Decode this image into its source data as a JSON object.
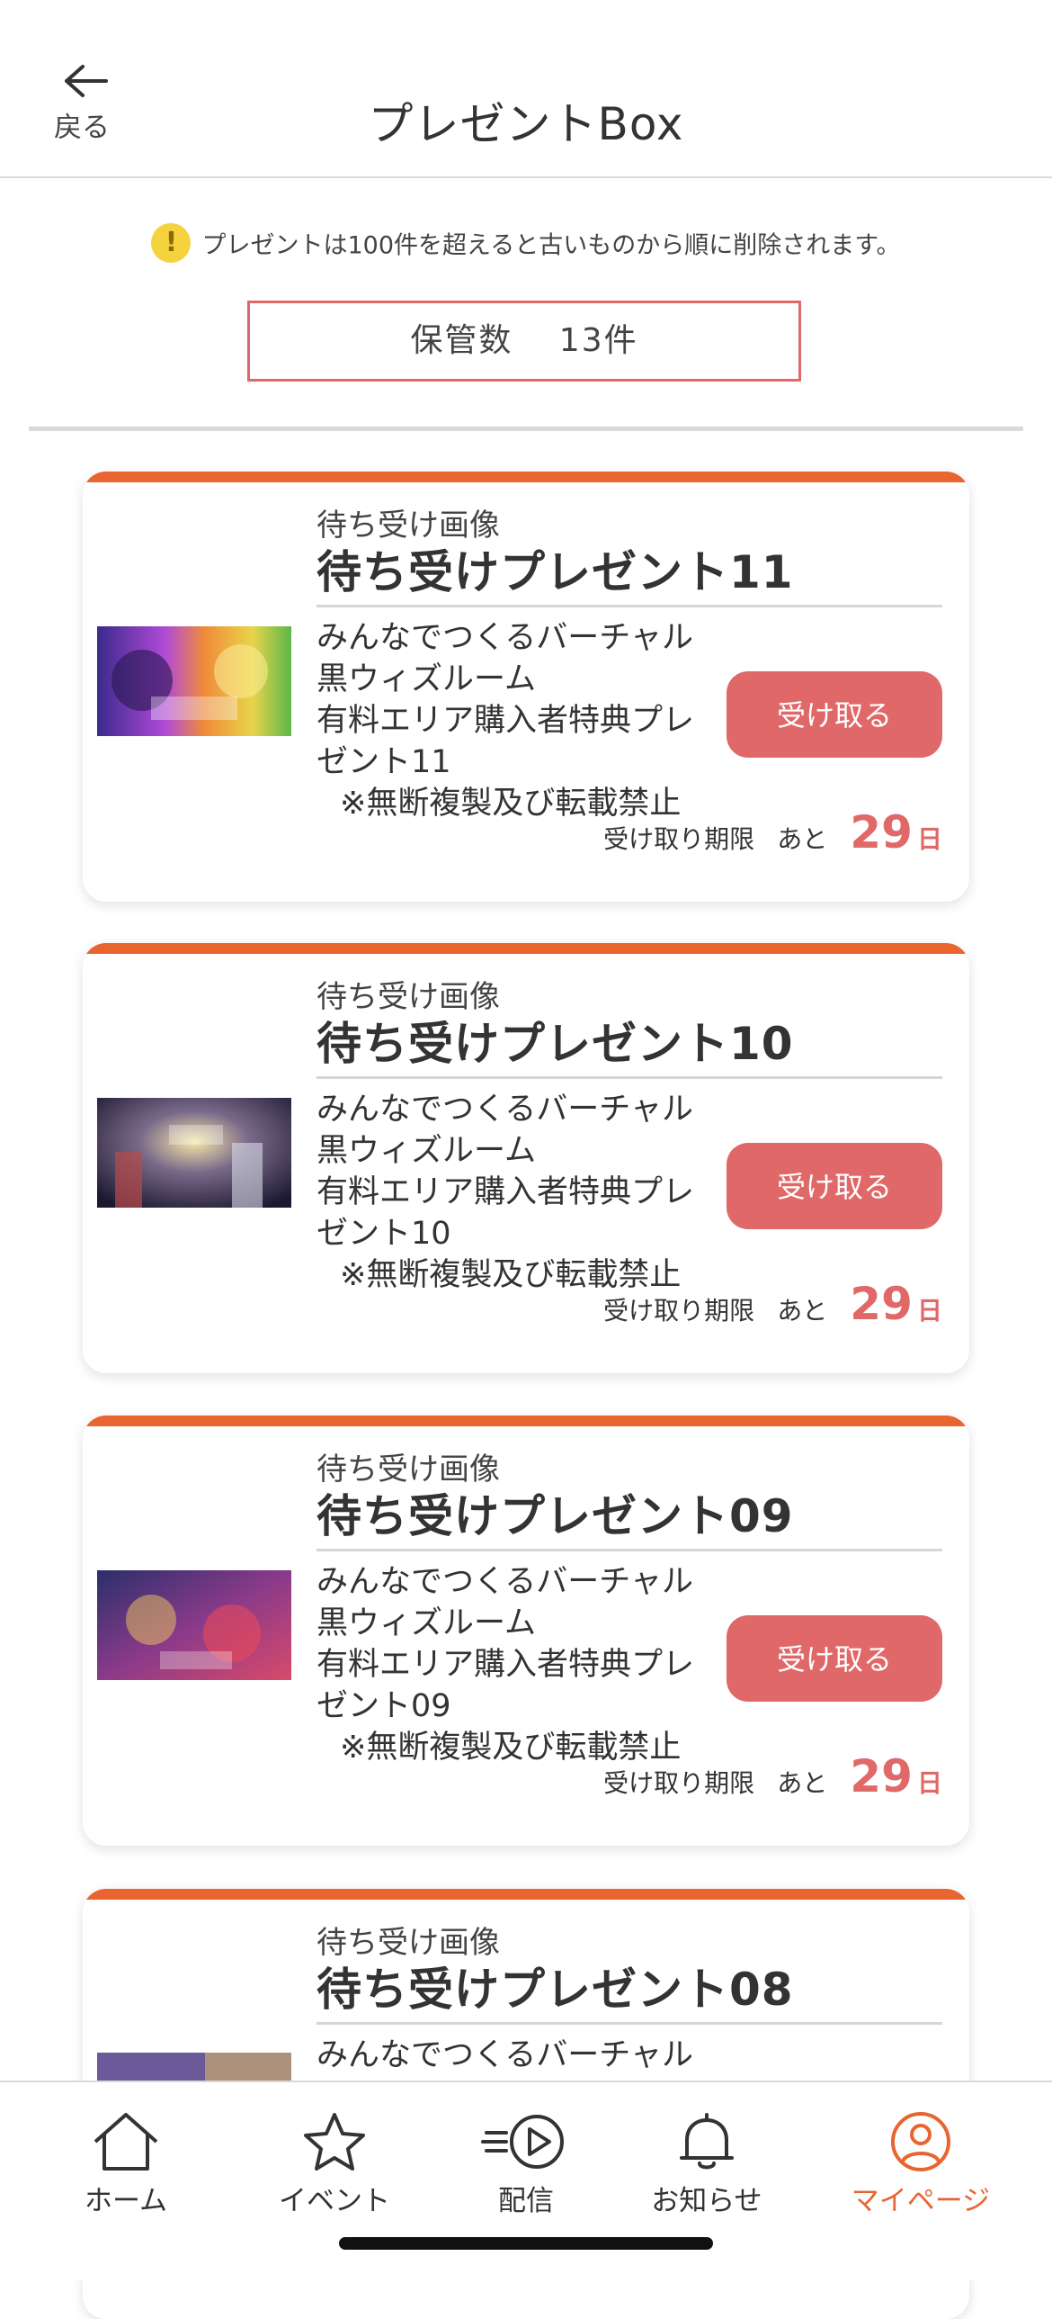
{
  "header": {
    "back_label": "戻る",
    "title": "プレゼントBox"
  },
  "notice": {
    "icon": "warning-icon",
    "text": "プレゼントは100件を超えると古いものから順に削除されます。"
  },
  "storage": {
    "label": "保管数　 13件"
  },
  "cards": [
    {
      "category": "待ち受け画像",
      "name": "待ち受けプレゼント11",
      "desc_lines": [
        "みんなでつくるバーチャル",
        "黒ウィズルーム",
        "有料エリア購入者特典プレ",
        "ゼント11"
      ],
      "notice": "※無断複製及び転載禁止",
      "button": "受け取る",
      "deadline_label": "受け取り期限",
      "remaining_prefix": "あと",
      "remaining_days": "29",
      "remaining_unit": "日"
    },
    {
      "category": "待ち受け画像",
      "name": "待ち受けプレゼント10",
      "desc_lines": [
        "みんなでつくるバーチャル",
        "黒ウィズルーム",
        "有料エリア購入者特典プレ",
        "ゼント10"
      ],
      "notice": "※無断複製及び転載禁止",
      "button": "受け取る",
      "deadline_label": "受け取り期限",
      "remaining_prefix": "あと",
      "remaining_days": "29",
      "remaining_unit": "日"
    },
    {
      "category": "待ち受け画像",
      "name": "待ち受けプレゼント09",
      "desc_lines": [
        "みんなでつくるバーチャル",
        "黒ウィズルーム",
        "有料エリア購入者特典プレ",
        "ゼント09"
      ],
      "notice": "※無断複製及び転載禁止",
      "button": "受け取る",
      "deadline_label": "受け取り期限",
      "remaining_prefix": "あと",
      "remaining_days": "29",
      "remaining_unit": "日"
    },
    {
      "category": "待ち受け画像",
      "name": "待ち受けプレゼント08",
      "desc_lines": [
        "みんなでつくるバーチャル"
      ]
    }
  ],
  "tabbar": {
    "items": [
      {
        "label": "ホーム",
        "icon": "home-icon"
      },
      {
        "label": "イベント",
        "icon": "star-icon"
      },
      {
        "label": "配信",
        "icon": "play-stream-icon"
      },
      {
        "label": "お知らせ",
        "icon": "bell-icon"
      },
      {
        "label": "マイページ",
        "icon": "user-icon",
        "active": true
      }
    ]
  },
  "colors": {
    "accent": "#e8652f",
    "button": "#e06868",
    "warning": "#f5d33e"
  }
}
